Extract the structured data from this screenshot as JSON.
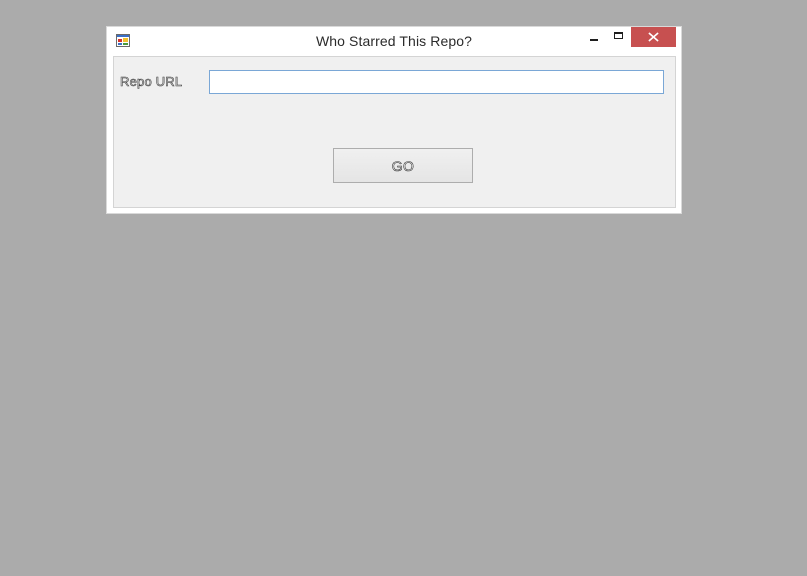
{
  "window": {
    "title": "Who Starred This Repo?",
    "app_icon": "winforms-app-icon",
    "controls": {
      "minimize_icon": "minimize-icon",
      "maximize_icon": "maximize-icon",
      "close_icon": "close-icon",
      "close_color": "#c75050"
    }
  },
  "form": {
    "repo_url_label": "Repo URL",
    "repo_url_value": "",
    "go_label": "GO"
  },
  "colors": {
    "desktop_background": "#ababab",
    "client_background": "#f0f0f0",
    "input_focus_border": "#7aa7d6"
  }
}
